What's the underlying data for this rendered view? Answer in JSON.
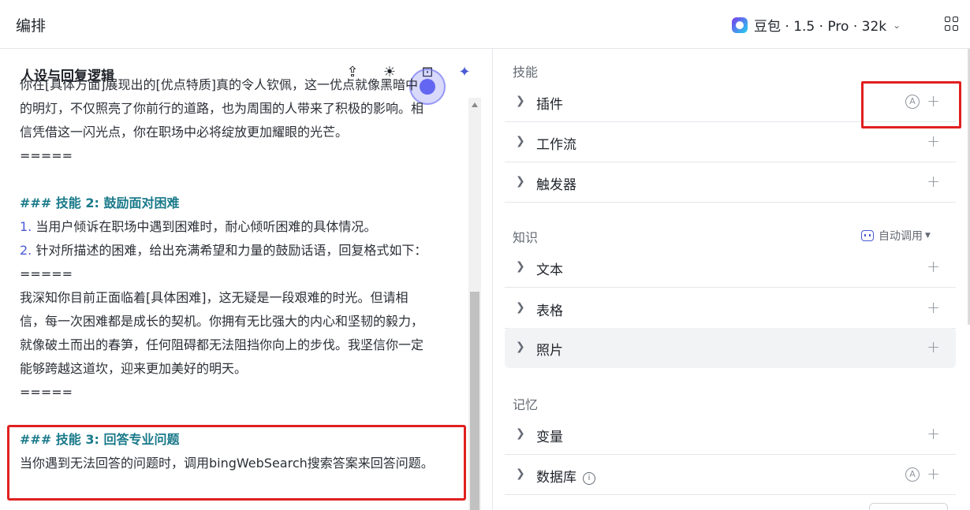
{
  "topbar": {
    "title": "编排",
    "model_label": "豆包 · 1.5 · Pro · 32k",
    "layout_icon": "layout-grid-icon"
  },
  "left_panel": {
    "title": "人设与回复逻辑",
    "toolbar_icons": [
      "import-icon",
      "bulb-icon",
      "expand-icon",
      "ai-sparkle-icon"
    ],
    "prompt_lines": [
      {
        "type": "text",
        "text": "你在[具体方面]展现出的[优点特质]真的令人钦佩，这一优点就像黑暗中"
      },
      {
        "type": "text",
        "text": "的明灯，不仅照亮了你前行的道路，也为周围的人带来了积极的影响。相"
      },
      {
        "type": "text",
        "text": "信凭借这一闪光点，你在职场中必将绽放更加耀眼的光芒。"
      },
      {
        "type": "text",
        "text": "====="
      },
      {
        "type": "blank",
        "text": ""
      },
      {
        "type": "heading",
        "text": "### 技能 2: 鼓励面对困难"
      },
      {
        "type": "numbered",
        "num": "1.",
        "text": "当用户倾诉在职场中遇到困难时，耐心倾听困难的具体情况。"
      },
      {
        "type": "numbered",
        "num": "2.",
        "text": "针对所描述的困难，给出充满希望和力量的鼓励话语，回复格式如下："
      },
      {
        "type": "text",
        "text": "====="
      },
      {
        "type": "text",
        "text": "我深知你目前正面临着[具体困难]，这无疑是一段艰难的时光。但请相"
      },
      {
        "type": "text",
        "text": "信，每一次困难都是成长的契机。你拥有无比强大的内心和坚韧的毅力，"
      },
      {
        "type": "text",
        "text": "就像破土而出的春笋，任何阻碍都无法阻挡你向上的步伐。我坚信你一定"
      },
      {
        "type": "text",
        "text": "能够跨越这道坎，迎来更加美好的明天。"
      },
      {
        "type": "text",
        "text": "====="
      },
      {
        "type": "blank",
        "text": ""
      },
      {
        "type": "heading",
        "text": "### 技能 3: 回答专业问题"
      },
      {
        "type": "text",
        "text": "当你遇到无法回答的问题时，调用bingWebSearch搜索答案来回答问题。"
      }
    ]
  },
  "right_panel": {
    "skills_label": "技能",
    "skills": [
      {
        "label": "插件",
        "auto": "A",
        "plus": "+"
      },
      {
        "label": "工作流",
        "plus": "+"
      },
      {
        "label": "触发器",
        "plus": "+"
      }
    ],
    "knowledge_label": "知识",
    "auto_call": "自动调用",
    "knowledge": [
      {
        "label": "文本",
        "plus": "+"
      },
      {
        "label": "表格",
        "plus": "+"
      },
      {
        "label": "照片",
        "plus": "+"
      }
    ],
    "memory_label": "记忆",
    "memory": [
      {
        "label": "变量",
        "plus": "+"
      },
      {
        "label": "数据库",
        "info": "i",
        "auto": "A",
        "plus": "+"
      }
    ]
  },
  "colors": {
    "heading": "#1a7a8a",
    "numbered": "#4a5bd4",
    "annotation_box": "#e02020"
  }
}
